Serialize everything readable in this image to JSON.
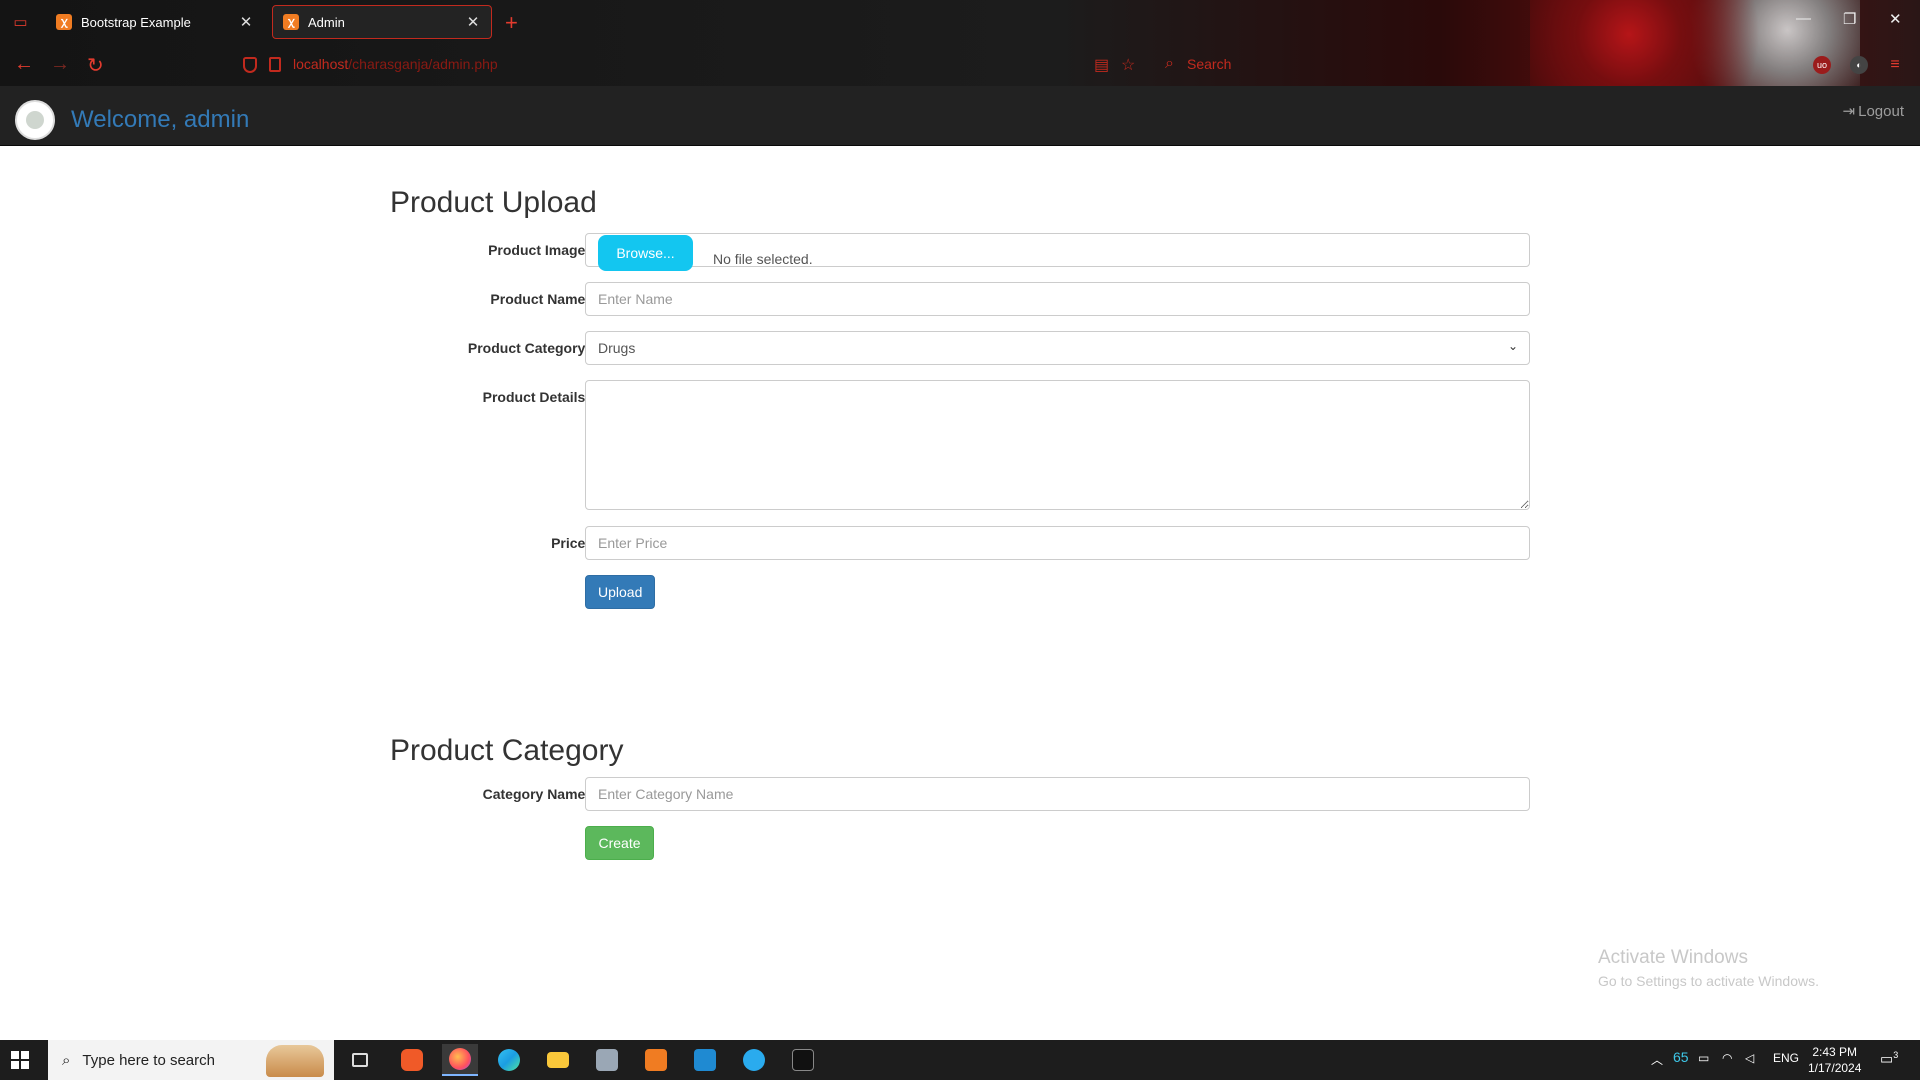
{
  "browser": {
    "tabs": [
      {
        "label": "Bootstrap Example",
        "active": false
      },
      {
        "label": "Admin",
        "active": true
      }
    ],
    "url_host": "localhost",
    "url_path": "/charasganja/admin.php",
    "search_placeholder": "Search",
    "accent_color": "#c22a1e"
  },
  "navbar": {
    "welcome": "Welcome, admin",
    "logout_label": "Logout",
    "brand_color": "#337ab7"
  },
  "upload_form": {
    "title": "Product Upload",
    "image_label": "Product Image:",
    "browse_label": "Browse...",
    "file_status": "No file selected.",
    "name_label": "Product Name:",
    "name_placeholder": "Enter Name",
    "category_label": "Product Category:",
    "category_selected": "Drugs",
    "details_label": "Product Details:",
    "details_value": "",
    "price_label": "Price:",
    "price_placeholder": "Enter Price",
    "submit_label": "Upload"
  },
  "category_form": {
    "title": "Product Category",
    "name_label": "Category Name:",
    "name_placeholder": "Enter Category Name",
    "submit_label": "Create"
  },
  "watermark": {
    "line1": "Activate Windows",
    "line2": "Go to Settings to activate Windows."
  },
  "taskbar": {
    "search_placeholder": "Type here to search",
    "temperature": "65",
    "language": "ENG",
    "time": "2:43 PM",
    "date": "1/17/2024",
    "notification_count": "3"
  }
}
